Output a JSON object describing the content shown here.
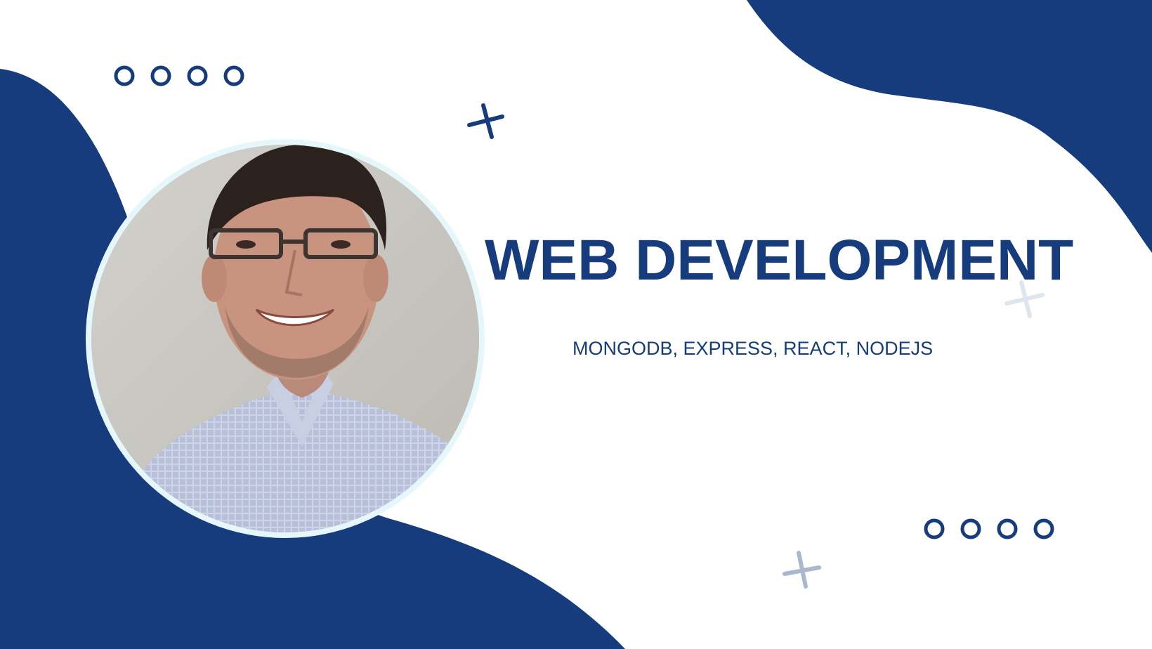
{
  "banner": {
    "title": "WEB DEVELOPMENT",
    "subtitle": "MONGODB, EXPRESS, REACT, NODEJS"
  },
  "colors": {
    "brand_blue": "#163c7e",
    "background": "#ffffff",
    "photo_ring": "#e6f7fc",
    "faint_cross": "#a9b7cf"
  },
  "decorations": {
    "circle_rows": [
      "ring-icon",
      "ring-icon"
    ],
    "crosses": [
      "plus-icon",
      "plus-icon",
      "plus-icon"
    ]
  },
  "portrait": {
    "description_icon": "person-portrait"
  }
}
